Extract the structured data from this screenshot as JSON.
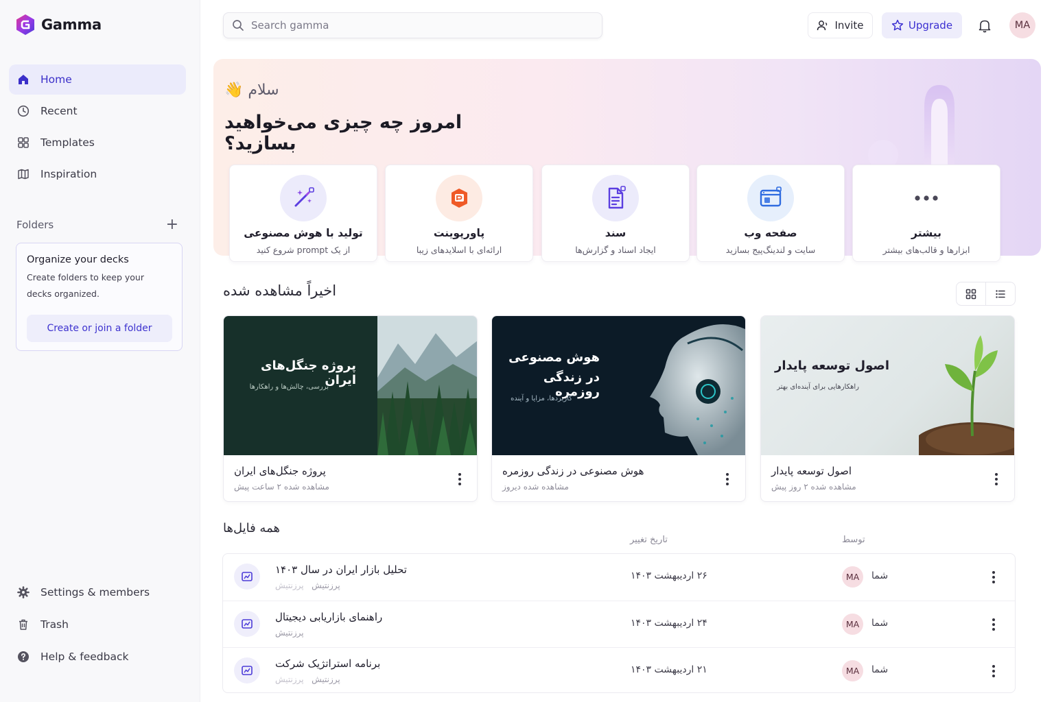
{
  "app": {
    "name": "Gamma"
  },
  "sidebar": {
    "nav": [
      {
        "label": "Home"
      },
      {
        "label": "Recent"
      },
      {
        "label": "Templates"
      },
      {
        "label": "Inspiration"
      }
    ],
    "folders_label": "Folders",
    "folder_card": {
      "title": "Organize your decks",
      "description": "Create folders to keep your decks organized.",
      "button": "Create or join a folder"
    },
    "bottom": [
      {
        "label": "Settings & members"
      },
      {
        "label": "Trash"
      },
      {
        "label": "Help & feedback"
      }
    ]
  },
  "topbar": {
    "search_placeholder": "Search gamma",
    "invite": "Invite",
    "upgrade": "Upgrade",
    "avatar": "MA"
  },
  "hero": {
    "greeting": "سلام",
    "wave": "👋",
    "title": "امروز چه چیزی می‌خواهید بسازید؟",
    "actions": [
      {
        "title": "تولید با هوش مصنوعی",
        "subtitle": "از یک prompt شروع کنید",
        "icon": "magic-wand-icon"
      },
      {
        "title": "پاورپوینت",
        "subtitle": "ارائه‌ای با اسلایدهای زیبا",
        "icon": "powerpoint-icon"
      },
      {
        "title": "سند",
        "subtitle": "ایجاد اسناد و گزارش‌ها",
        "icon": "document-icon"
      },
      {
        "title": "صفحه وب",
        "subtitle": "سایت و لندینگ‌پیج بسازید",
        "icon": "webpage-icon"
      },
      {
        "title": "بیشتر",
        "subtitle": "ابزارها و قالب‌های بیشتر",
        "icon": "more-icon"
      }
    ]
  },
  "recent": {
    "title": "اخیراً مشاهده شده",
    "cards": [
      {
        "thumb_title": "پروژه جنگل‌های ایران",
        "thumb_sub": "بررسی، چالش‌ها و راهکارها",
        "name": "پروژه جنگل‌های ایران",
        "meta": "مشاهده شده ۲ ساعت پیش"
      },
      {
        "thumb_title_1": "هوش مصنوعی",
        "thumb_title_2": "در زندگی روزمره",
        "thumb_sub": "کاربردها، مزایا و آینده",
        "name": "هوش مصنوعی در زندگی روزمره",
        "meta": "مشاهده شده دیروز"
      },
      {
        "thumb_title": "اصول توسعه پایدار",
        "thumb_sub": "راهکارهایی برای آینده‌ای بهتر",
        "name": "اصول توسعه پایدار",
        "meta": "مشاهده شده ۲ روز پیش"
      }
    ]
  },
  "files": {
    "title": "همه فایل‌ها",
    "columns": {
      "modified": "تاریخ تغییر",
      "by": "توسط"
    },
    "rows": [
      {
        "name": "تحلیل بازار ایران در سال ۱۴۰۳",
        "type": "پرزنتیش",
        "type2": "پرزنتیش",
        "date": "۲۶ اردیبهشت ۱۴۰۳",
        "owner": "شما",
        "avatar": "MA"
      },
      {
        "name": "راهنمای بازاریابی دیجیتال",
        "type": "پرزنتیش",
        "type2": "پرزنتیش",
        "date": "۲۴ اردیبهشت ۱۴۰۳",
        "owner": "شما",
        "avatar": "MA"
      },
      {
        "name": "برنامه استراتژیک شرکت",
        "type": "پرزنتیش",
        "type2": "پرزنتیش",
        "date": "۲۱ اردیبهشت ۱۴۰۳",
        "owner": "شما",
        "avatar": "MA"
      }
    ]
  },
  "colors": {
    "accent": "#3b2fc9",
    "accent_bg": "#ebebfb",
    "avatar_bg": "#f6dde2"
  }
}
